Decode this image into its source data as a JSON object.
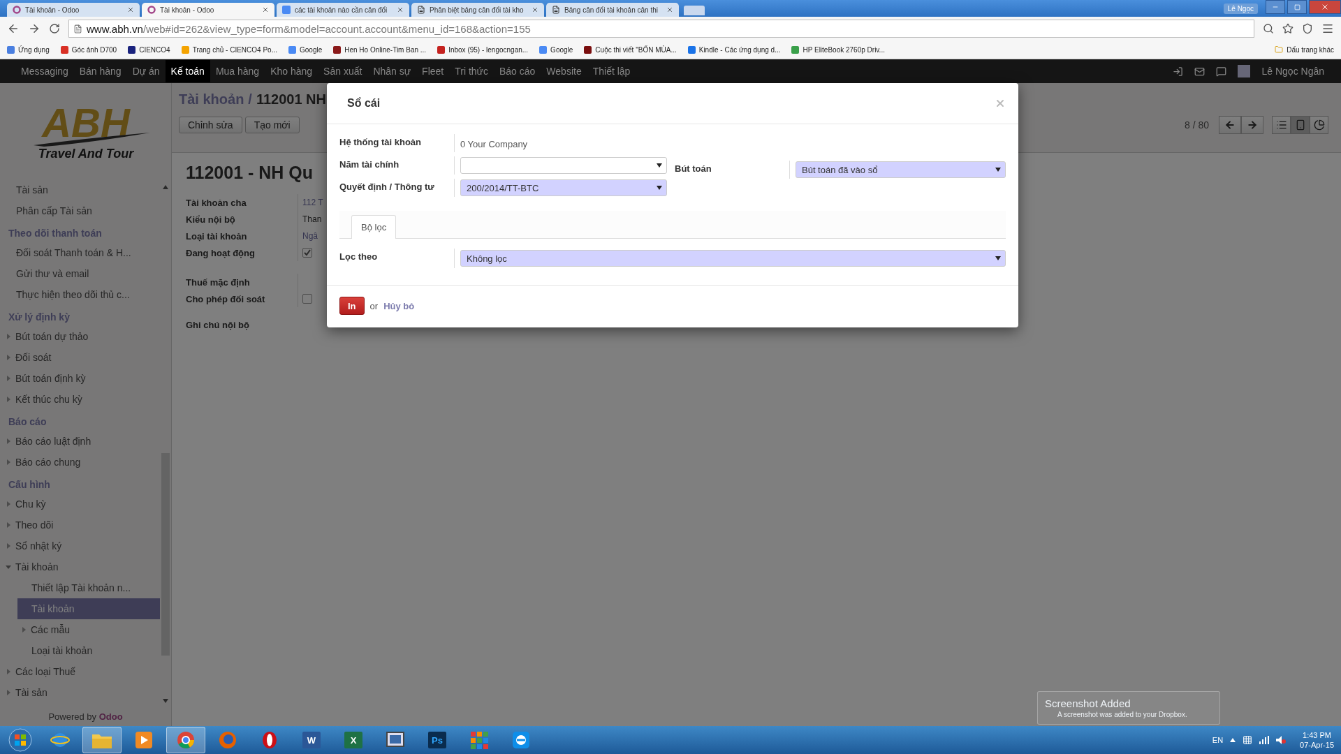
{
  "browser": {
    "tabs": [
      {
        "title": "Tài khoản - Odoo",
        "kind": "odoo",
        "selected": false
      },
      {
        "title": "Tài khoản - Odoo",
        "kind": "odoo",
        "selected": true
      },
      {
        "title": "các tài khoản nào cần cân đối",
        "kind": "google",
        "selected": false
      },
      {
        "title": "Phân biệt bảng cân đối tài kho",
        "kind": "page",
        "selected": false
      },
      {
        "title": "Bảng cân đối tài khoản cân thi",
        "kind": "page",
        "selected": false
      }
    ],
    "profile": "Lê Ngọc",
    "url_host": "www.abh.vn",
    "url_rest": "/web#id=262&view_type=form&model=account.account&menu_id=168&action=155",
    "bookmarks": [
      {
        "label": "Ứng dụng",
        "color": "#4a7fe0"
      },
      {
        "label": "Góc ảnh D700",
        "color": "#d93025"
      },
      {
        "label": "CIENCO4",
        "color": "#1a237e"
      },
      {
        "label": "Trang chủ - CIENCO4 Po...",
        "color": "#f4a300"
      },
      {
        "label": "Google",
        "color": "#4a8af4"
      },
      {
        "label": "Hen Ho Online-Tim Ban ...",
        "color": "#8b1a1a"
      },
      {
        "label": "Inbox (95) - lengocngan...",
        "color": "#c5221f"
      },
      {
        "label": "Google",
        "color": "#4a8af4"
      },
      {
        "label": "Cuộc thi viết \"BỐN MÙA...",
        "color": "#7a0e0e"
      },
      {
        "label": "Kindle - Các ứng dụng d...",
        "color": "#1a73e8"
      },
      {
        "label": "HP EliteBook 2760p Driv...",
        "color": "#3aa04a"
      }
    ],
    "other_bookmarks": "Dấu trang khác"
  },
  "nav": {
    "items": [
      {
        "label": "Messaging",
        "selected": false
      },
      {
        "label": "Bán hàng",
        "selected": false
      },
      {
        "label": "Dự án",
        "selected": false
      },
      {
        "label": "Kế toán",
        "selected": true
      },
      {
        "label": "Mua hàng",
        "selected": false
      },
      {
        "label": "Kho hàng",
        "selected": false
      },
      {
        "label": "Sản xuất",
        "selected": false
      },
      {
        "label": "Nhân sự",
        "selected": false
      },
      {
        "label": "Fleet",
        "selected": false
      },
      {
        "label": "Tri thức",
        "selected": false
      },
      {
        "label": "Báo cáo",
        "selected": false
      },
      {
        "label": "Website",
        "selected": false
      },
      {
        "label": "Thiết lập",
        "selected": false
      }
    ],
    "user": "Lê Ngọc Ngân"
  },
  "sidebar": {
    "logo": {
      "mark": "ABH",
      "tagline": "Travel And Tour"
    },
    "groups": [
      {
        "items": [
          {
            "label": "Tài sản",
            "selected": false
          },
          {
            "label": "Phân cấp Tài sản",
            "selected": false
          }
        ]
      },
      {
        "title": "Theo dõi thanh toán",
        "items": [
          {
            "label": "Đối soát Thanh toán & H...",
            "selected": false
          },
          {
            "label": "Gửi thư và email",
            "selected": false
          },
          {
            "label": "Thực hiện theo dõi thủ c...",
            "selected": false
          }
        ]
      },
      {
        "title": "Xử lý định kỳ",
        "items": [
          {
            "label": "Bút toán dự thảo",
            "expanded": false,
            "selected": false
          },
          {
            "label": "Đối soát",
            "expanded": false,
            "selected": false
          },
          {
            "label": "Bút toán định kỳ",
            "expanded": false,
            "selected": false
          },
          {
            "label": "Kết thúc chu kỳ",
            "expanded": false,
            "selected": false
          }
        ]
      },
      {
        "title": "Báo cáo",
        "items": [
          {
            "label": "Báo cáo luật định",
            "expanded": false,
            "selected": false
          },
          {
            "label": "Báo cáo chung",
            "expanded": false,
            "selected": false
          }
        ]
      },
      {
        "title": "Cấu hình",
        "items": [
          {
            "label": "Chu kỳ",
            "expanded": false,
            "selected": false
          },
          {
            "label": "Theo dõi",
            "expanded": false,
            "selected": false
          },
          {
            "label": "Sổ nhật ký",
            "expanded": false,
            "selected": false
          },
          {
            "label": "Tài khoản",
            "expanded": true,
            "selected": false,
            "children": [
              {
                "label": "Thiết lập Tài khoản n...",
                "selected": false
              },
              {
                "label": "Tài khoản",
                "selected": true
              },
              {
                "label": "Các mẫu",
                "expanded": false,
                "selected": false
              },
              {
                "label": "Loại tài khoản",
                "selected": false
              }
            ]
          },
          {
            "label": "Các loại Thuế",
            "expanded": false,
            "selected": false
          },
          {
            "label": "Tài sản",
            "expanded": false,
            "selected": false
          }
        ]
      }
    ],
    "powered_by": "Powered by",
    "powered_brand": "Odoo"
  },
  "header": {
    "breadcrumb_link": "Tài khoản",
    "breadcrumb_separator": "/",
    "breadcrumb_current": "112001 NH",
    "buttons": [
      "Chỉnh sửa",
      "Tạo mới"
    ],
    "pager": "8 / 80",
    "views": [
      {
        "kind": "list",
        "selected": false
      },
      {
        "kind": "form",
        "selected": true
      },
      {
        "kind": "graph",
        "selected": false
      }
    ]
  },
  "form": {
    "title": "112001 - NH Qu",
    "groups": [
      [
        {
          "label": "Tài khoản cha",
          "kind": "link",
          "value": "112 T"
        },
        {
          "label": "Kiểu nội bộ",
          "kind": "text",
          "value": "Than"
        },
        {
          "label": "Loại tài khoản",
          "kind": "link",
          "value": "Ngâ"
        },
        {
          "label": "Đang hoạt động",
          "kind": "checkbox",
          "checked": true
        }
      ],
      [
        {
          "label": "Thuế mặc định",
          "kind": "empty"
        },
        {
          "label": "Cho phép đối soát",
          "kind": "checkbox",
          "checked": false
        }
      ]
    ],
    "note_label": "Ghi chú nội bộ"
  },
  "dialog": {
    "title": "Sổ cái",
    "left_fields": [
      {
        "label": "Hệ thống tài khoản",
        "kind": "text",
        "value": "0 Your Company"
      },
      {
        "label": "Năm tài chính",
        "kind": "select",
        "required": false
      },
      {
        "label": "Quyết định / Thông tư",
        "kind": "select",
        "required": true,
        "value": "200/2014/TT-BTC"
      }
    ],
    "right_fields": [
      {
        "label": "Bút toán",
        "kind": "select",
        "required": true,
        "value": "Bút toán đã vào sổ"
      }
    ],
    "tabs": [
      {
        "label": "Bộ lọc",
        "selected": true
      }
    ],
    "filter_field": {
      "label": "Lọc theo",
      "kind": "select",
      "required": true,
      "value": "Không lọc"
    },
    "primary_button": "In",
    "or_text": "or",
    "cancel_link": "Hủy bỏ"
  },
  "notification": {
    "title": "Screenshot Added",
    "message": "A screenshot was added to your Dropbox."
  },
  "taskbar": {
    "apps": [
      {
        "kind": "ie",
        "running": false
      },
      {
        "kind": "explorer",
        "running": true
      },
      {
        "kind": "media",
        "running": false
      },
      {
        "kind": "chrome",
        "running": true
      },
      {
        "kind": "firefox",
        "running": false
      },
      {
        "kind": "opera",
        "running": false
      },
      {
        "kind": "word",
        "glyph": "W",
        "running": false
      },
      {
        "kind": "excel",
        "glyph": "X",
        "running": false
      },
      {
        "kind": "screen",
        "running": false
      },
      {
        "kind": "photoshop",
        "glyph": "Ps",
        "running": false
      },
      {
        "kind": "apps",
        "running": false
      },
      {
        "kind": "teamviewer",
        "running": false
      }
    ],
    "language": "EN",
    "time": "1:43 PM",
    "date": "07-Apr-15"
  }
}
